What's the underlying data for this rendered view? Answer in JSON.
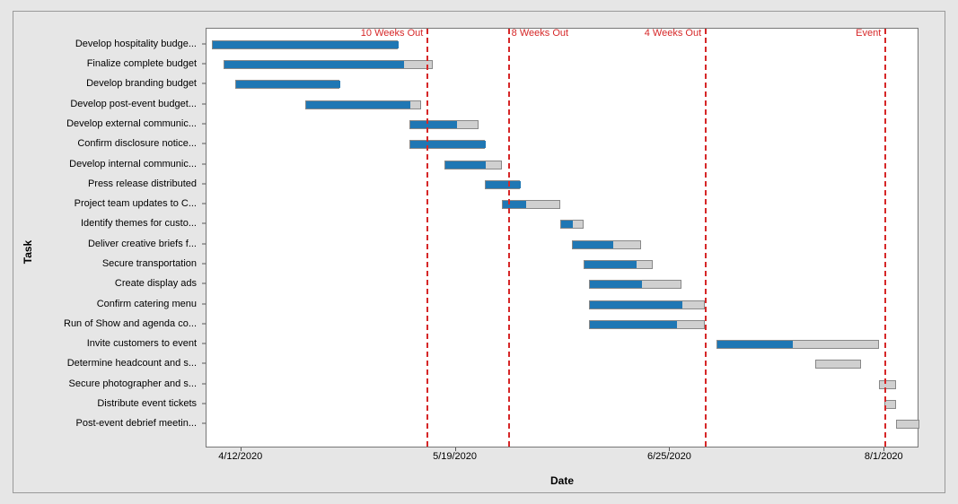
{
  "chart_data": {
    "type": "bar",
    "title": "",
    "xlabel": "Date",
    "ylabel": "Task",
    "x_ticks": [
      "4/12/2020",
      "5/19/2020",
      "6/25/2020",
      "8/1/2020"
    ],
    "x_range_serial": [
      43927,
      44050
    ],
    "tasks": [
      {
        "label": "Develop hospitality budge...",
        "full": "Develop hospitality budget",
        "start": 43928,
        "blue_end": 43960,
        "grey_end": 43960
      },
      {
        "label": "Finalize complete budget",
        "full": "Finalize complete budget",
        "start": 43930,
        "blue_end": 43961,
        "grey_end": 43966
      },
      {
        "label": "Develop branding budget",
        "full": "Develop branding budget",
        "start": 43932,
        "blue_end": 43950,
        "grey_end": 43950
      },
      {
        "label": "Develop post-event budget...",
        "full": "Develop post-event budget",
        "start": 43944,
        "blue_end": 43962,
        "grey_end": 43964
      },
      {
        "label": "Develop external communic...",
        "full": "Develop external communications",
        "start": 43962,
        "blue_end": 43970,
        "grey_end": 43974
      },
      {
        "label": "Confirm disclosure notice...",
        "full": "Confirm disclosure notices",
        "start": 43962,
        "blue_end": 43975,
        "grey_end": 43975
      },
      {
        "label": "Develop internal communic...",
        "full": "Develop internal communications",
        "start": 43968,
        "blue_end": 43975,
        "grey_end": 43978
      },
      {
        "label": "Press release distributed",
        "full": "Press release distributed",
        "start": 43975,
        "blue_end": 43981,
        "grey_end": 43981
      },
      {
        "label": "Project team updates to C...",
        "full": "Project team updates to Customer",
        "start": 43978,
        "blue_end": 43982,
        "grey_end": 43988
      },
      {
        "label": "Identify themes for custo...",
        "full": "Identify themes for customer",
        "start": 43988,
        "blue_end": 43990,
        "grey_end": 43992
      },
      {
        "label": "Deliver creative briefs f...",
        "full": "Deliver creative briefs for",
        "start": 43990,
        "blue_end": 43997,
        "grey_end": 44002
      },
      {
        "label": "Secure transportation",
        "full": "Secure transportation",
        "start": 43992,
        "blue_end": 44001,
        "grey_end": 44004
      },
      {
        "label": "Create display ads",
        "full": "Create display ads",
        "start": 43993,
        "blue_end": 44002,
        "grey_end": 44009
      },
      {
        "label": "Confirm catering menu",
        "full": "Confirm catering menu",
        "start": 43993,
        "blue_end": 44009,
        "grey_end": 44013
      },
      {
        "label": "Run of Show and agenda co...",
        "full": "Run of Show and agenda confirmed",
        "start": 43993,
        "blue_end": 44008,
        "grey_end": 44013
      },
      {
        "label": "Invite customers to event",
        "full": "Invite customers to event",
        "start": 44015,
        "blue_end": 44028,
        "grey_end": 44043
      },
      {
        "label": "Determine headcount and s...",
        "full": "Determine headcount and seating",
        "start": 44032,
        "blue_end": 44032,
        "grey_end": 44040
      },
      {
        "label": "Secure photographer and s...",
        "full": "Secure photographer and staff",
        "start": 44043,
        "blue_end": 44043,
        "grey_end": 44046
      },
      {
        "label": "Distribute event tickets",
        "full": "Distribute event tickets",
        "start": 44044,
        "blue_end": 44044,
        "grey_end": 44046
      },
      {
        "label": "Post-event debrief meetin...",
        "full": "Post-event debrief meeting",
        "start": 44046,
        "blue_end": 44046,
        "grey_end": 44050
      }
    ],
    "reference_lines": [
      {
        "label": "10 Weeks Out",
        "serial": 43965,
        "label_align": "right"
      },
      {
        "label": "8 Weeks Out",
        "serial": 43979,
        "label_align": "left"
      },
      {
        "label": "4 Weeks Out",
        "serial": 44013,
        "label_align": "right"
      },
      {
        "label": "Event",
        "serial": 44044,
        "label_align": "right"
      }
    ],
    "colors": {
      "bar": "#1f77b4",
      "bar_secondary": "#d0d0d0",
      "refline": "#d62728"
    }
  }
}
